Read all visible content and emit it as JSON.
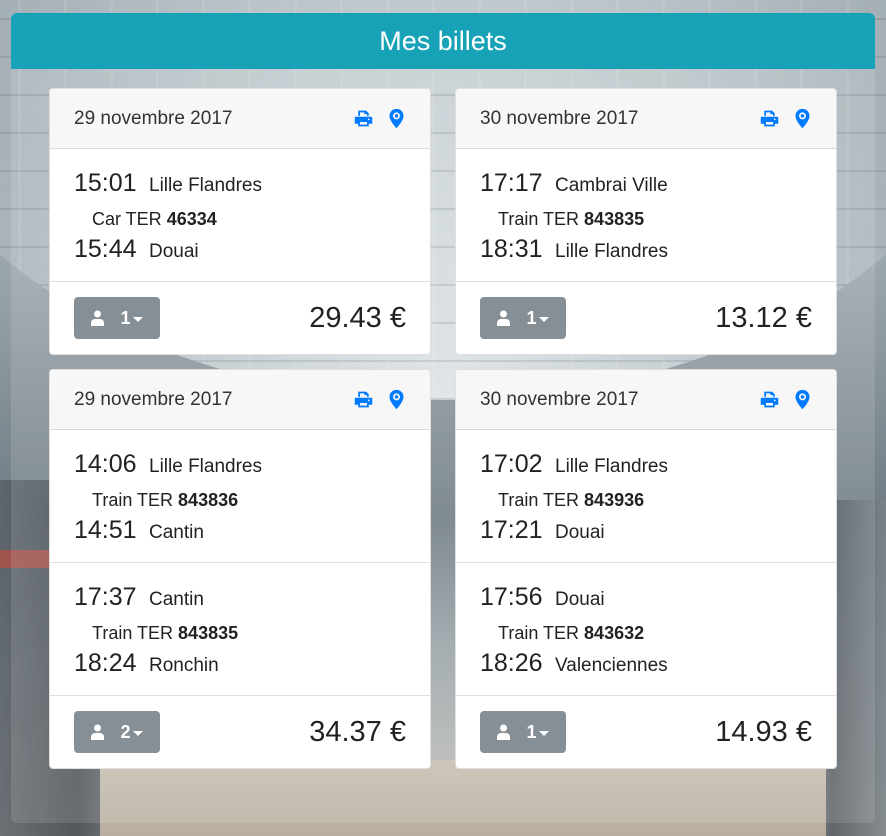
{
  "header": {
    "title": "Mes billets"
  },
  "colors": {
    "header_bg": "#17a2b8",
    "icon_blue": "#007bff",
    "button_gray": "#868e96"
  },
  "icons": {
    "print": "print-icon",
    "map": "map-marker-icon",
    "user": "user-icon"
  },
  "tickets": [
    {
      "date": "29 novembre 2017",
      "segments": [
        {
          "dep_time": "15:01",
          "dep_station": "Lille Flandres",
          "mode": "Car TER",
          "number": "46334",
          "arr_time": "15:44",
          "arr_station": "Douai"
        }
      ],
      "passengers": "1",
      "price": "29.43 €"
    },
    {
      "date": "30 novembre 2017",
      "segments": [
        {
          "dep_time": "17:17",
          "dep_station": "Cambrai Ville",
          "mode": "Train TER",
          "number": "843835",
          "arr_time": "18:31",
          "arr_station": "Lille Flandres"
        }
      ],
      "passengers": "1",
      "price": "13.12 €"
    },
    {
      "date": "29 novembre 2017",
      "segments": [
        {
          "dep_time": "14:06",
          "dep_station": "Lille Flandres",
          "mode": "Train TER",
          "number": "843836",
          "arr_time": "14:51",
          "arr_station": "Cantin"
        },
        {
          "dep_time": "17:37",
          "dep_station": "Cantin",
          "mode": "Train TER",
          "number": "843835",
          "arr_time": "18:24",
          "arr_station": "Ronchin"
        }
      ],
      "passengers": "2",
      "price": "34.37 €"
    },
    {
      "date": "30 novembre 2017",
      "segments": [
        {
          "dep_time": "17:02",
          "dep_station": "Lille Flandres",
          "mode": "Train TER",
          "number": "843936",
          "arr_time": "17:21",
          "arr_station": "Douai"
        },
        {
          "dep_time": "17:56",
          "dep_station": "Douai",
          "mode": "Train TER",
          "number": "843632",
          "arr_time": "18:26",
          "arr_station": "Valenciennes"
        }
      ],
      "passengers": "1",
      "price": "14.93 €"
    }
  ]
}
